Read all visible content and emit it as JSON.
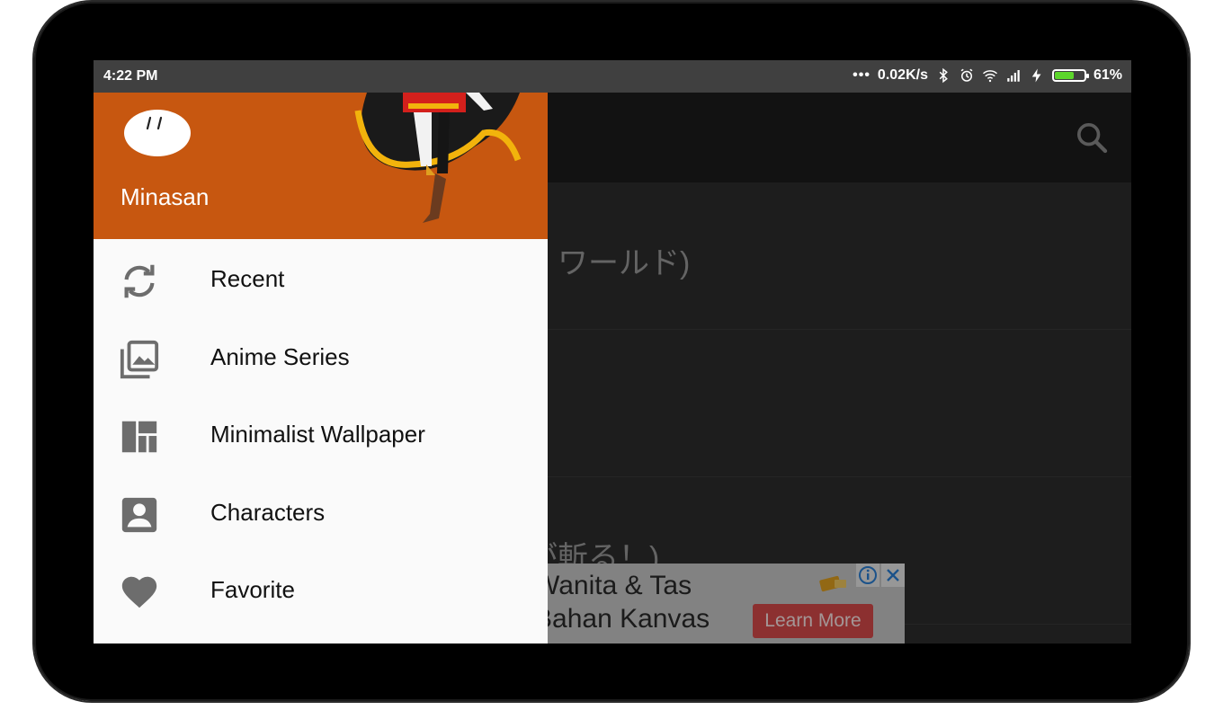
{
  "status_bar": {
    "time": "4:22 PM",
    "net_speed": "0.02K/s",
    "battery_percent": "61%",
    "battery_level": 0.61
  },
  "toolbar": {
    "search_icon": "search-icon"
  },
  "content_list": [
    {
      "partial_title": "ル・ワールド)"
    },
    {
      "partial_title": ")"
    },
    {
      "partial_title": "ムが斬る！)"
    }
  ],
  "ad": {
    "line1": "Wanita & Tas",
    "line2": "Bahan Kanvas",
    "cta": "Learn More"
  },
  "drawer": {
    "user_name": "Minasan",
    "header_color": "#c75710",
    "items": [
      {
        "label": "Recent",
        "icon": "sync-icon"
      },
      {
        "label": "Anime Series",
        "icon": "photo-library-icon"
      },
      {
        "label": "Minimalist Wallpaper",
        "icon": "dashboard-icon"
      },
      {
        "label": "Characters",
        "icon": "account-box-icon"
      },
      {
        "label": "Favorite",
        "icon": "heart-icon"
      }
    ]
  }
}
